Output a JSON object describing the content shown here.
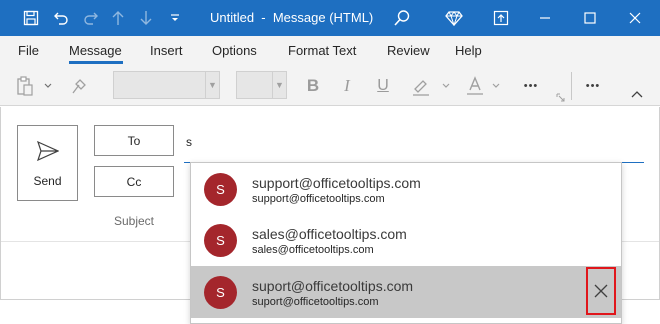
{
  "window": {
    "title": "Untitled  -  Message (HTML)"
  },
  "ribbon": {
    "tabs": [
      {
        "label": "File"
      },
      {
        "label": "Message"
      },
      {
        "label": "Insert"
      },
      {
        "label": "Options"
      },
      {
        "label": "Format Text"
      },
      {
        "label": "Review"
      },
      {
        "label": "Help"
      }
    ],
    "active_tab": "Message"
  },
  "toolbar": {
    "bold": "B",
    "italic": "I",
    "underline": "U",
    "more": "•••"
  },
  "compose": {
    "send_label": "Send",
    "to_label": "To",
    "cc_label": "Cc",
    "subject_label": "Subject",
    "to_value": "s"
  },
  "suggestions": [
    {
      "initial": "S",
      "name": "support@officetooltips.com",
      "email": "support@officetooltips.com",
      "selected": false
    },
    {
      "initial": "S",
      "name": "sales@officetooltips.com",
      "email": "sales@officetooltips.com",
      "selected": false
    },
    {
      "initial": "S",
      "name": "suport@officetooltips.com",
      "email": "suport@officetooltips.com",
      "selected": true
    }
  ],
  "colors": {
    "accent": "#1e6fc1",
    "avatar": "#a4262c",
    "highlight": "#e0161b"
  }
}
